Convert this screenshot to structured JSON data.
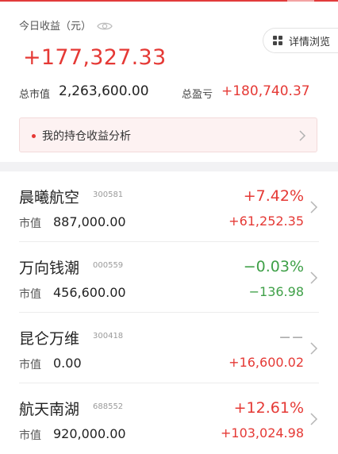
{
  "summary": {
    "today_label": "今日收益（元）",
    "today_value": "+177,327.33",
    "detail_button_label": "详情浏览",
    "market_value_label": "总市值",
    "market_value": "2,263,600.00",
    "total_pl_label": "总盈亏",
    "total_pl_value": "+180,740.37",
    "analysis_label": "我的持仓收益分析"
  },
  "holdings": [
    {
      "name": "晨曦航空",
      "code": "300581",
      "mv_label": "市值",
      "market_value": "887,000.00",
      "change_pct": "+7.42%",
      "profit": "+61,252.35",
      "pct_color": "red",
      "profit_color": "red"
    },
    {
      "name": "万向钱潮",
      "code": "000559",
      "mv_label": "市值",
      "market_value": "456,600.00",
      "change_pct": "−0.03%",
      "profit": "−136.98",
      "pct_color": "green",
      "profit_color": "green"
    },
    {
      "name": "昆仑万维",
      "code": "300418",
      "mv_label": "市值",
      "market_value": "0.00",
      "change_pct": "−−",
      "profit": "+16,600.02",
      "pct_color": "gray",
      "profit_color": "red"
    },
    {
      "name": "航天南湖",
      "code": "688552",
      "mv_label": "市值",
      "market_value": "920,000.00",
      "change_pct": "+12.61%",
      "profit": "+103,024.98",
      "pct_color": "red",
      "profit_color": "red"
    }
  ],
  "colors": {
    "accent_red": "#e53935",
    "loss_green": "#3fa048",
    "neutral_gray": "#aaaaaa"
  },
  "icons": {
    "eye": "eye-icon",
    "detail": "grid-icon",
    "chevron": "chevron-right-icon",
    "bullet": "dot-icon"
  }
}
